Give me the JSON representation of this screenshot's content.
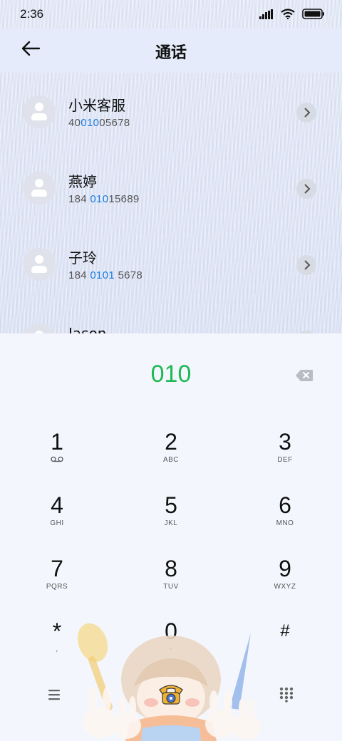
{
  "status": {
    "time": "2:36"
  },
  "header": {
    "title": "通话"
  },
  "contacts": [
    {
      "name": "小米客服",
      "num_pre": "40",
      "num_hl": "010",
      "num_post": "05678"
    },
    {
      "name": "燕婷",
      "num_pre": "184 ",
      "num_hl": "010",
      "num_post": "15689"
    },
    {
      "name": "子玲",
      "num_pre": "184 ",
      "num_hl": "0101",
      "num_post": " 5678"
    },
    {
      "name": "Jason"
    }
  ],
  "dialer": {
    "number": "010",
    "keys": [
      {
        "digit": "1",
        "letters": ""
      },
      {
        "digit": "2",
        "letters": "ABC"
      },
      {
        "digit": "3",
        "letters": "DEF"
      },
      {
        "digit": "4",
        "letters": "GHI"
      },
      {
        "digit": "5",
        "letters": "JKL"
      },
      {
        "digit": "6",
        "letters": "MNO"
      },
      {
        "digit": "7",
        "letters": "PQRS"
      },
      {
        "digit": "8",
        "letters": "TUV"
      },
      {
        "digit": "9",
        "letters": "WXYZ"
      },
      {
        "digit": "*",
        "letters": ","
      },
      {
        "digit": "0",
        "letters": "+"
      },
      {
        "digit": "#",
        "letters": ""
      }
    ]
  },
  "icons": {
    "back": "arrow-left-icon",
    "chevron": "chevron-right-icon",
    "backspace": "backspace-icon",
    "voicemail": "voicemail-icon",
    "menu": "menu-icon",
    "dialpad": "dialpad-icon",
    "call": "phone-icon"
  },
  "colors": {
    "number": "#1db954",
    "highlight": "#1e7be0"
  }
}
